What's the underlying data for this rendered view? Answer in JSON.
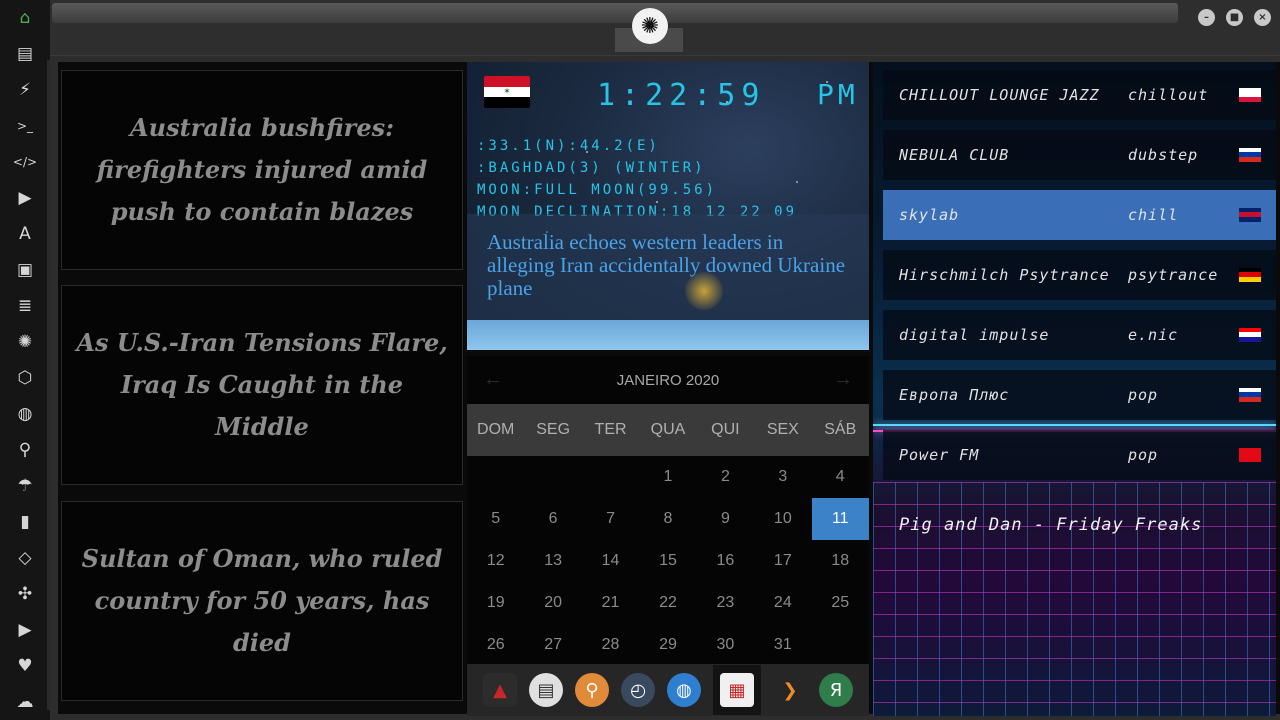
{
  "sidebar": {
    "items": [
      {
        "name": "home-icon",
        "glyph": "⌂"
      },
      {
        "name": "document-icon",
        "glyph": "▤"
      },
      {
        "name": "lightning-icon",
        "glyph": "⚡"
      },
      {
        "name": "terminal-icon",
        "glyph": ">_"
      },
      {
        "name": "code-icon",
        "glyph": "</>"
      },
      {
        "name": "play-icon",
        "glyph": "▶"
      },
      {
        "name": "translate-icon",
        "glyph": "A"
      },
      {
        "name": "image-icon",
        "glyph": "▣"
      },
      {
        "name": "news-icon",
        "glyph": "≣"
      },
      {
        "name": "rebel-icon",
        "glyph": "✺"
      },
      {
        "name": "hexagon-icon",
        "glyph": "⬡"
      },
      {
        "name": "globe-icon",
        "glyph": "◍"
      },
      {
        "name": "search-icon",
        "glyph": "⚲"
      },
      {
        "name": "umbrella-icon",
        "glyph": "☂"
      },
      {
        "name": "contacts-icon",
        "glyph": "▮"
      },
      {
        "name": "git-icon",
        "glyph": "◇"
      },
      {
        "name": "expand-icon",
        "glyph": "✣"
      },
      {
        "name": "youtube-icon",
        "glyph": "▶"
      },
      {
        "name": "heart-icon",
        "glyph": "♥"
      },
      {
        "name": "cloud-icon",
        "glyph": "☁"
      }
    ]
  },
  "topbar": {
    "emblem": "rebel-alliance-emblem",
    "minimize": "–",
    "maximize": "■",
    "close": "×"
  },
  "news": {
    "items": [
      "Australia bushfires: firefighters injured amid push to contain blazes",
      "As U.S.-Iran Tensions Flare, Iraq Is Caught in the Middle",
      "Sultan of Oman, who ruled country for 50 years, has died"
    ]
  },
  "clock": {
    "time": "1:22:59",
    "ampm": "PM",
    "lines": [
      ":33.1(N):44.2(E)",
      ":BAGHDAD(3) (WINTER)",
      "MOON:FULL MOON(99.56)",
      "MOON DECLINATION:18 12 22 09"
    ],
    "headline": "Australia echoes western leaders in alleging Iran accidentally downed Ukraine plane",
    "flag_colors": [
      "#ce1126",
      "#ffffff",
      "#000000"
    ]
  },
  "calendar": {
    "month": "JANEIRO 2020",
    "prev": "←",
    "next": "→",
    "weekdays": [
      "DOM",
      "SEG",
      "TER",
      "QUA",
      "QUI",
      "SEX",
      "SÁB"
    ],
    "weeks": [
      [
        "",
        "",
        "",
        "1",
        "2",
        "3",
        "4"
      ],
      [
        "5",
        "6",
        "7",
        "8",
        "9",
        "10",
        "11"
      ],
      [
        "12",
        "13",
        "14",
        "15",
        "16",
        "17",
        "18"
      ],
      [
        "19",
        "20",
        "21",
        "22",
        "23",
        "24",
        "25"
      ],
      [
        "26",
        "27",
        "28",
        "29",
        "30",
        "31",
        ""
      ]
    ],
    "today": "11",
    "accent": "#3b82c9"
  },
  "dock": {
    "apps": [
      {
        "name": "arrow-app-icon",
        "glyph": "▲",
        "color": "#c62828",
        "bg": "#2c2c2c"
      },
      {
        "name": "news-app-icon",
        "glyph": "▤",
        "color": "#333333",
        "bg": "#e0e0e0"
      },
      {
        "name": "search-app-icon",
        "glyph": "⚲",
        "color": "#ffffff",
        "bg": "#e08a3a"
      },
      {
        "name": "clock-app-icon",
        "glyph": "◴",
        "color": "#ffffff",
        "bg": "#3a4a5e"
      },
      {
        "name": "globe-app-icon",
        "glyph": "◍",
        "color": "#ffffff",
        "bg": "#2f7fd0"
      },
      {
        "name": "calendar-app-icon",
        "glyph": "▦",
        "color": "#c62828",
        "bg": "#f0f0f0"
      },
      {
        "name": "play-app-icon",
        "glyph": "❯",
        "color": "#f08a24",
        "bg": "#262626"
      },
      {
        "name": "yandex-app-icon",
        "glyph": "Я",
        "color": "#ffffff",
        "bg": "#2e7d4a"
      }
    ]
  },
  "radio": {
    "stations": [
      {
        "name": "CHILLOUT LOUNGE JAZZ",
        "genre": "chillout",
        "flag": [
          "#ffffff",
          "#ffffff",
          "#dc143c"
        ]
      },
      {
        "name": "NEBULA CLUB",
        "genre": "dubstep",
        "flag": [
          "#ffffff",
          "#0039a6",
          "#d52b1e"
        ]
      },
      {
        "name": "skylab",
        "genre": "chill",
        "flag": [
          "#012169",
          "#c8102e",
          "#012169"
        ]
      },
      {
        "name": "Hirschmilch Psytrance",
        "genre": "psytrance",
        "flag": [
          "#000000",
          "#dd0000",
          "#ffce00"
        ]
      },
      {
        "name": "digital impulse",
        "genre": "e.nic",
        "flag": [
          "#ff0000",
          "#ffffff",
          "#171796"
        ]
      },
      {
        "name": "Европа Плюс",
        "genre": "pop",
        "flag": [
          "#ffffff",
          "#0039a6",
          "#d52b1e"
        ]
      },
      {
        "name": "Power FM",
        "genre": "pop",
        "flag": [
          "#e30a17",
          "#e30a17",
          "#e30a17"
        ]
      }
    ],
    "selected": 2,
    "now_playing": "Pig and Dan - Friday Freaks"
  }
}
